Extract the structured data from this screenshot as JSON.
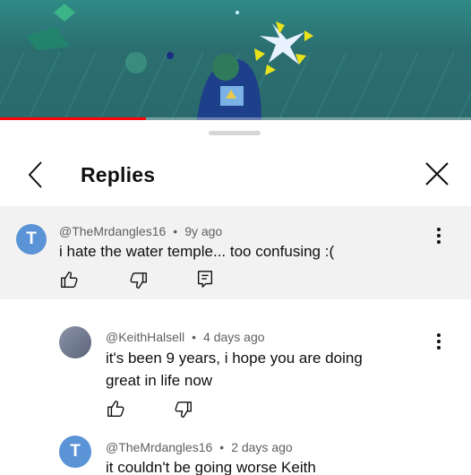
{
  "header": {
    "title": "Replies"
  },
  "video": {
    "progress": 0.31
  },
  "colors": {
    "accent_red": "#ff0000",
    "avatar_blue": "#5a93d6",
    "avatar_gray": "#6b7a90"
  },
  "comments": [
    {
      "author": "@TheMrdangles16",
      "separator": "•",
      "age": "9y ago",
      "text": "i hate the water temple... too confusing :(",
      "avatar_letter": "T"
    },
    {
      "author": "@KeithHalsell",
      "separator": "•",
      "age": "4 days ago",
      "text_line1": "it's been 9 years, i hope you are doing",
      "text_line2": "great in life now"
    },
    {
      "author": "@TheMrdangles16",
      "separator": "•",
      "age": "2 days ago",
      "text": "it couldn't be going worse Keith",
      "avatar_letter": "T"
    }
  ]
}
